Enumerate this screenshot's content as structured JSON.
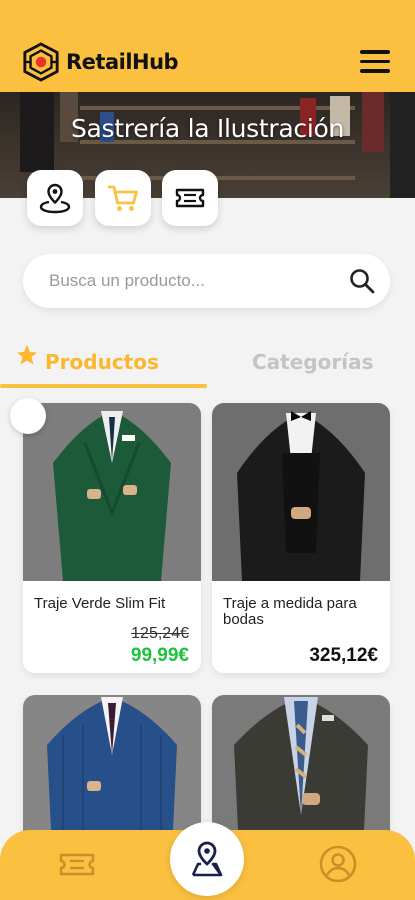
{
  "app": {
    "brand_name": "RetailHub"
  },
  "colors": {
    "accent": "#fbc03f",
    "sale_price": "#1fc23c",
    "icon_dark": "#1b1f4b"
  },
  "store": {
    "name": "Sastrería la Ilustración"
  },
  "quick_actions": [
    {
      "icon": "map-pin-icon"
    },
    {
      "icon": "cart-icon"
    },
    {
      "icon": "ticket-icon"
    }
  ],
  "search": {
    "placeholder": "Busca un producto..."
  },
  "tabs": [
    {
      "label": "Productos",
      "active": true
    },
    {
      "label": "Categorías",
      "active": false
    }
  ],
  "products": [
    {
      "name": "Traje Verde Slim Fit",
      "old_price": "125,24€",
      "price": "99,99€",
      "suit_color": "#1d5a3a"
    },
    {
      "name": "Traje a medida para bodas",
      "old_price": "",
      "price": "325,12€",
      "suit_color": "#1b1b1b"
    },
    {
      "name": "",
      "old_price": "",
      "price": "",
      "suit_color": "#27508a"
    },
    {
      "name": "",
      "old_price": "",
      "price": "",
      "suit_color": "#3b3b36"
    }
  ],
  "bottom_nav": [
    {
      "icon": "ticket-icon"
    },
    {
      "icon": "map-pin-icon",
      "active": true
    },
    {
      "icon": "user-icon"
    }
  ]
}
